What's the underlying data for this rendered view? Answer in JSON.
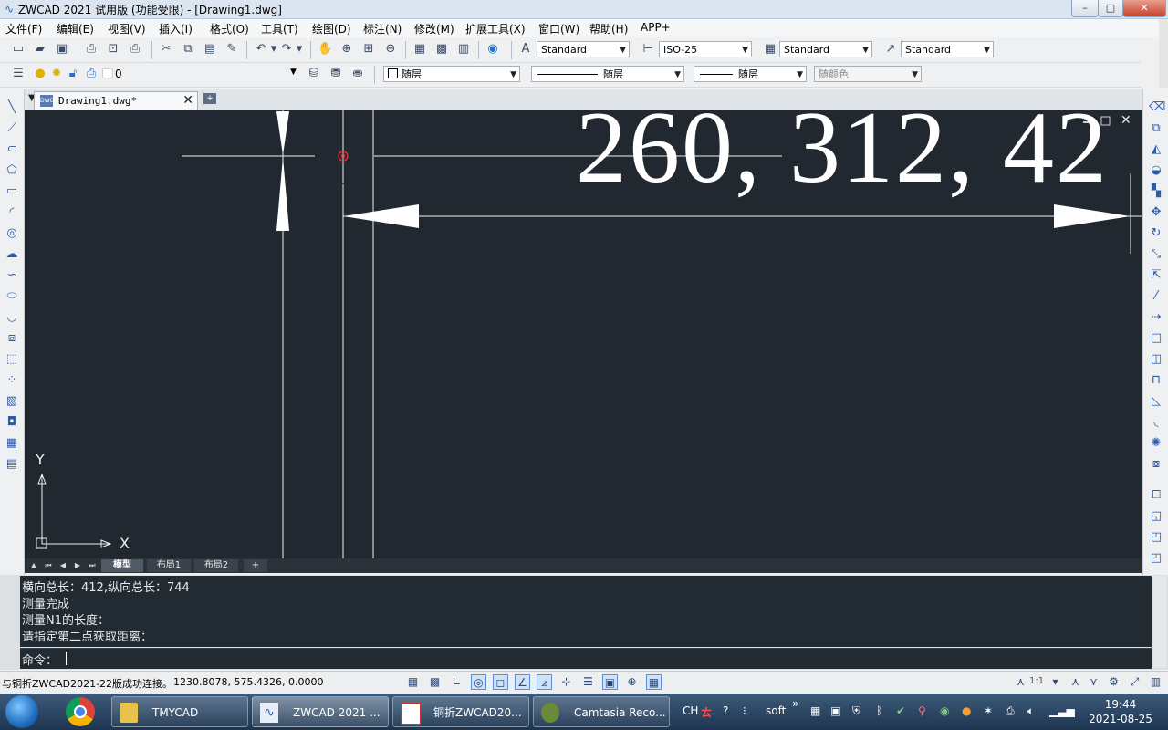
{
  "window": {
    "title": "ZWCAD 2021 试用版 (功能受限) - [Drawing1.dwg]",
    "min": "–",
    "max": "□",
    "close": "✕"
  },
  "menu": [
    "文件(F)",
    "编辑(E)",
    "视图(V)",
    "插入(I)",
    "格式(O)",
    "工具(T)",
    "绘图(D)",
    "标注(N)",
    "修改(M)",
    "扩展工具(X)",
    "窗口(W)",
    "帮助(H)",
    "APP+"
  ],
  "toolbar1": {
    "text_style": "Standard",
    "dim_style": "ISO-25",
    "table_style": "Standard",
    "multileader_style": "Standard"
  },
  "toolbar2": {
    "layer": "0",
    "color": "随层",
    "linetype": "随层",
    "lineweight": "随层",
    "plotstyle": "随颜色"
  },
  "doc_tab": {
    "icon_text": "DWG",
    "label": "Drawing1.dwg*",
    "close": "✕",
    "new": "+"
  },
  "canvas": {
    "dim_text": "260, 312, 42",
    "axis_y": "Y",
    "axis_x": "X"
  },
  "layout_tabs": [
    "模型",
    "布局1",
    "布局2",
    "+"
  ],
  "command": {
    "history": [
      "横向总长：412,纵向总长：744",
      "测量完成",
      "测量N1的长度：",
      "请指定第二点获取距离："
    ],
    "prompt": "命令："
  },
  "status": {
    "message": "与铜折ZWCAD2021-22版成功连接。",
    "coords": "1230.8078, 575.4326, 0.0000",
    "scale": "1:1"
  },
  "taskbar": {
    "items": [
      "TMYCAD",
      "ZWCAD 2021 ...",
      "铜折ZWCAD20...",
      "Camtasia Reco..."
    ],
    "lang": "CH",
    "ime": "soft",
    "time": "19:44",
    "date": "2021-08-25"
  },
  "colors": {
    "canvas_bg": "#212830",
    "cmd_bg": "#222a32",
    "titlebar": "#dbe5f1",
    "marker": "#e03030"
  }
}
